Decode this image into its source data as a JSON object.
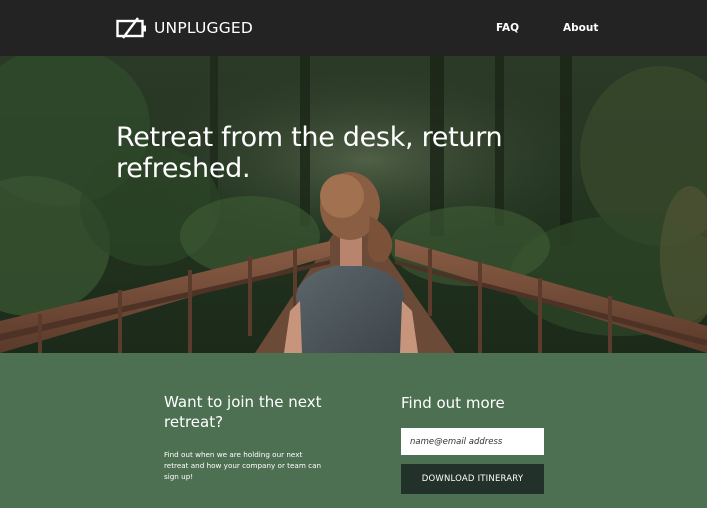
{
  "header": {
    "logo_text": "UNPLUGGED",
    "nav": {
      "faq": "FAQ",
      "about": "About"
    }
  },
  "hero": {
    "title": "Retreat from the desk, return refreshed."
  },
  "signup": {
    "join_heading": "Want to join the next retreat?",
    "join_text": "Find out when we are holding our next retreat and how your company or team can sign up!",
    "more_heading": "Find out more",
    "email_placeholder": "name@email address",
    "download_label": "DOWNLOAD ITINERARY"
  },
  "colors": {
    "header_bg": "#232323",
    "section_bg": "#4e7052",
    "button_bg": "#22312a"
  },
  "icons": [
    "battery-off-logo-icon"
  ]
}
